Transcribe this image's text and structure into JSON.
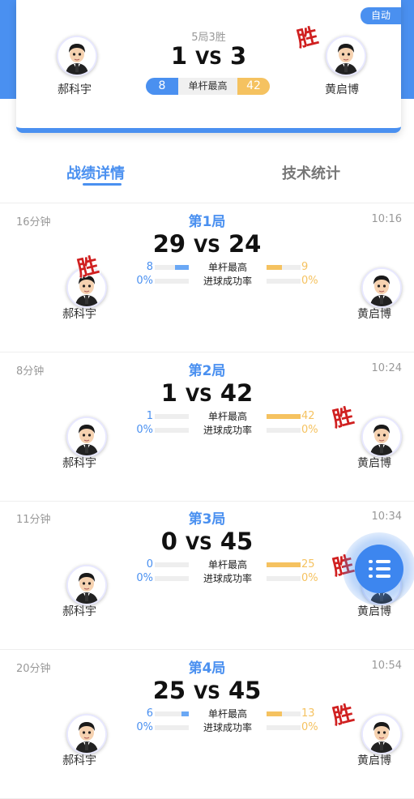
{
  "header": {
    "auto_badge": "自动",
    "format": "5局3胜",
    "left_player": "郝科宇",
    "right_player": "黄启博",
    "left_score": "1",
    "right_score": "3",
    "vs": "VS",
    "win_label": "胜",
    "high_break_label": "单杆最高",
    "left_high_break": "8",
    "right_high_break": "42",
    "winner": "right"
  },
  "tabs": {
    "active": "战绩详情",
    "other": "技术统计"
  },
  "labels": {
    "high_break": "单杆最高",
    "success_rate": "进球成功率",
    "win": "胜",
    "vs": "VS"
  },
  "games": [
    {
      "duration": "16分钟",
      "title": "第1局",
      "time": "10:16",
      "left_score": "29",
      "right_score": "24",
      "left_hb": "8",
      "right_hb": "9",
      "left_rate": "0%",
      "right_rate": "0%",
      "winner": "left",
      "left_name": "郝科宇",
      "right_name": "黄启博"
    },
    {
      "duration": "8分钟",
      "title": "第2局",
      "time": "10:24",
      "left_score": "1",
      "right_score": "42",
      "left_hb": "1",
      "right_hb": "42",
      "left_rate": "0%",
      "right_rate": "0%",
      "winner": "right",
      "left_name": "郝科宇",
      "right_name": "黄启博"
    },
    {
      "duration": "11分钟",
      "title": "第3局",
      "time": "10:34",
      "left_score": "0",
      "right_score": "45",
      "left_hb": "0",
      "right_hb": "25",
      "left_rate": "0%",
      "right_rate": "0%",
      "winner": "right",
      "left_name": "郝科宇",
      "right_name": "黄启博"
    },
    {
      "duration": "20分钟",
      "title": "第4局",
      "time": "10:54",
      "left_score": "25",
      "right_score": "45",
      "left_hb": "6",
      "right_hb": "13",
      "left_rate": "0%",
      "right_rate": "0%",
      "winner": "right",
      "left_name": "郝科宇",
      "right_name": "黄启博"
    }
  ],
  "colors": {
    "accent": "#4a90f0",
    "secondary": "#f5c260",
    "win": "#d02020"
  },
  "icons": {
    "fab": "menu-list-icon",
    "avatar": "player-avatar-icon"
  }
}
